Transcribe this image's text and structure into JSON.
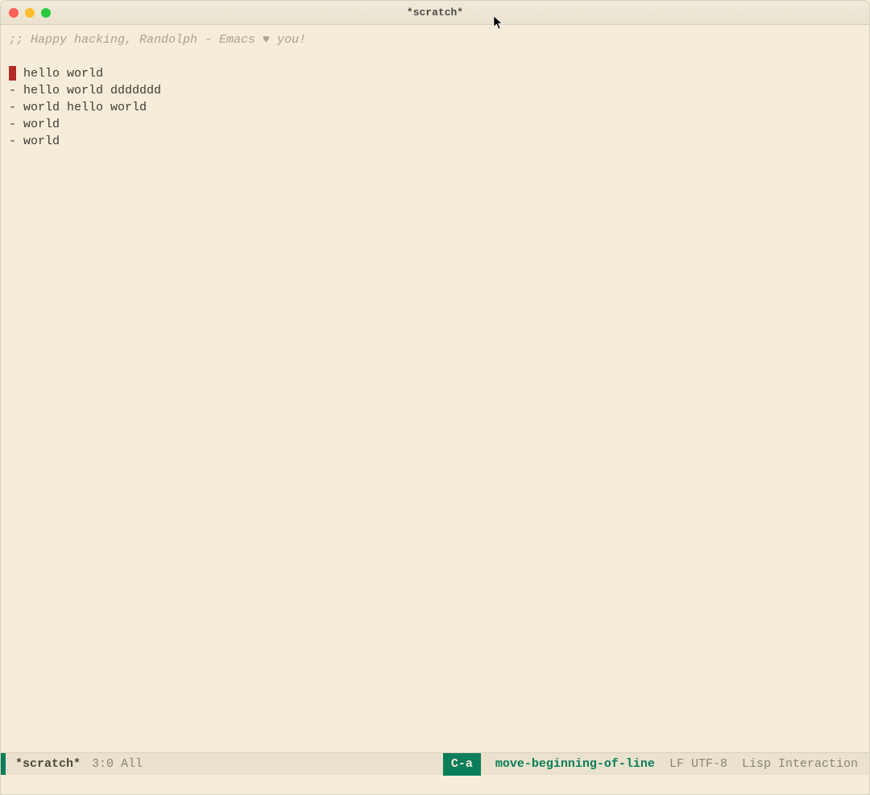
{
  "window": {
    "title": "*scratch*"
  },
  "buffer": {
    "comment": ";; Happy hacking, Randolph - Emacs ♥ you!",
    "lines": [
      " hello world",
      "- hello world ddddddd",
      "- world hello world",
      "- world",
      "- world"
    ],
    "cursor_line_prefix": ""
  },
  "modeline": {
    "buffer_name": "*scratch*",
    "position": "3:0",
    "scroll": "All",
    "keychord": "C-a",
    "command": "move-beginning-of-line",
    "encoding": "LF UTF-8",
    "major_mode": "Lisp Interaction"
  }
}
